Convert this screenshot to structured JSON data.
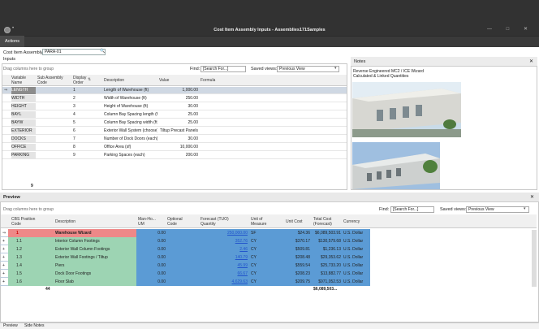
{
  "window": {
    "title": "Cost Item Assembly Inputs - Assemblies171Samples",
    "menu": "•",
    "buttons": "— □ ✕"
  },
  "ribbon": {
    "actions_tab": "Actions"
  },
  "assembly": {
    "label": "Cost Item Assembly:",
    "value": "PARA-01"
  },
  "inputs": {
    "label": "Inputs",
    "group_hint": "Drag columns here to group",
    "find_label": "Find:",
    "find_placeholder": "[Search For...]",
    "saved_views_label": "Saved views:",
    "saved_views_value": "Previous View",
    "columns": [
      "Variable Name",
      "Sub Assembly Code",
      "Display Order",
      "Description",
      "Value",
      "Formula"
    ],
    "rows": [
      {
        "name": "LENGTH",
        "sub": "",
        "order": "1",
        "desc": "Length of Warehouse (ft)",
        "value": "1,000.00",
        "formula": ""
      },
      {
        "name": "WIDTH",
        "sub": "",
        "order": "2",
        "desc": "Width of Warehouse (ft)",
        "value": "250.00",
        "formula": ""
      },
      {
        "name": "HEIGHT",
        "sub": "",
        "order": "3",
        "desc": "Height of Warehouse (ft)",
        "value": "30.00",
        "formula": ""
      },
      {
        "name": "BAYL",
        "sub": "",
        "order": "4",
        "desc": "Column Bay Spacing length (ft)",
        "value": "25.00",
        "formula": ""
      },
      {
        "name": "BAYW",
        "sub": "",
        "order": "5",
        "desc": "Column Bay Spacing width (ft)",
        "value": "25.00",
        "formula": ""
      },
      {
        "name": "EXTERIOR",
        "sub": "",
        "order": "6",
        "desc": "Exterior Wall System (choose)",
        "value": "Tiltup Precast Panels",
        "formula": ""
      },
      {
        "name": "DOCKS",
        "sub": "",
        "order": "7",
        "desc": "Number of Dock Doors (each)",
        "value": "30.00",
        "formula": ""
      },
      {
        "name": "OFFICE",
        "sub": "",
        "order": "8",
        "desc": "Office Area (sf)",
        "value": "10,000.00",
        "formula": ""
      },
      {
        "name": "PARKING",
        "sub": "",
        "order": "9",
        "desc": "Parking Spaces (each)",
        "value": "200.00",
        "formula": ""
      }
    ],
    "footer_count": "9"
  },
  "notes": {
    "title": "Notes",
    "line1": "Reverse Engineered MC2 / ICE Wizard",
    "line2": "Calculated & Linked Quantities"
  },
  "preview": {
    "title": "Preview",
    "group_hint": "Drag columns here to group",
    "find_label": "Find:",
    "find_placeholder": "[Search For...]",
    "saved_views_label": "Saved views:",
    "saved_views_value": "Previous View",
    "columns": [
      "CBS Position Code",
      "Description",
      "Man-Ho... UM",
      "Optional Code",
      "Forecast (TUO) Quantity",
      "Unit of Measure",
      "Unit Cost",
      "Total Cost (Forecast)",
      "Currency"
    ],
    "rows": [
      {
        "code": "1",
        "desc": "Warehouse Wizard",
        "mh": "0.00",
        "opt": "",
        "qty": "250,000.00",
        "uom": "SF",
        "unit": "$24.36",
        "total": "$6,089,503.91",
        "cur": "U.S. Dollar"
      },
      {
        "code": "1.1",
        "desc": "Interior Column Footings",
        "mh": "0.00",
        "opt": "",
        "qty": "352.76",
        "uom": "CY",
        "unit": "$370.17",
        "total": "$130,579.68",
        "cur": "U.S. Dollar"
      },
      {
        "code": "1.2",
        "desc": "Exterior Wall Column Footings",
        "mh": "0.00",
        "opt": "",
        "qty": "2.46",
        "uom": "CY",
        "unit": "$509.81",
        "total": "$1,236.13",
        "cur": "U.S. Dollar"
      },
      {
        "code": "1.3",
        "desc": "Exterior Wall Footings / Tiltup",
        "mh": "0.00",
        "opt": "",
        "qty": "140.79",
        "uom": "CY",
        "unit": "$208.48",
        "total": "$29,353.62",
        "cur": "U.S. Dollar"
      },
      {
        "code": "1.4",
        "desc": "Piers",
        "mh": "0.00",
        "opt": "",
        "qty": "45.99",
        "uom": "CY",
        "unit": "$559.54",
        "total": "$25,733.20",
        "cur": "U.S. Dollar"
      },
      {
        "code": "1.5",
        "desc": "Dock Door Footings",
        "mh": "0.00",
        "opt": "",
        "qty": "66.67",
        "uom": "CY",
        "unit": "$208.23",
        "total": "$13,882.77",
        "cur": "U.S. Dollar"
      },
      {
        "code": "1.6",
        "desc": "Floor Slab",
        "mh": "0.00",
        "opt": "",
        "qty": "4,629.63",
        "uom": "CY",
        "unit": "$209.75",
        "total": "$971,052.53",
        "cur": "U.S. Dollar"
      }
    ],
    "footer_count": "44",
    "footer_total": "$6,089,503..."
  },
  "bottom_tabs": [
    "Preview",
    "Side Notes"
  ],
  "colors": {
    "selected_row": "#cfd8e3",
    "preview_green": "#9dd4b3",
    "preview_blue": "#5b9bd5",
    "header_red": "#e88"
  }
}
